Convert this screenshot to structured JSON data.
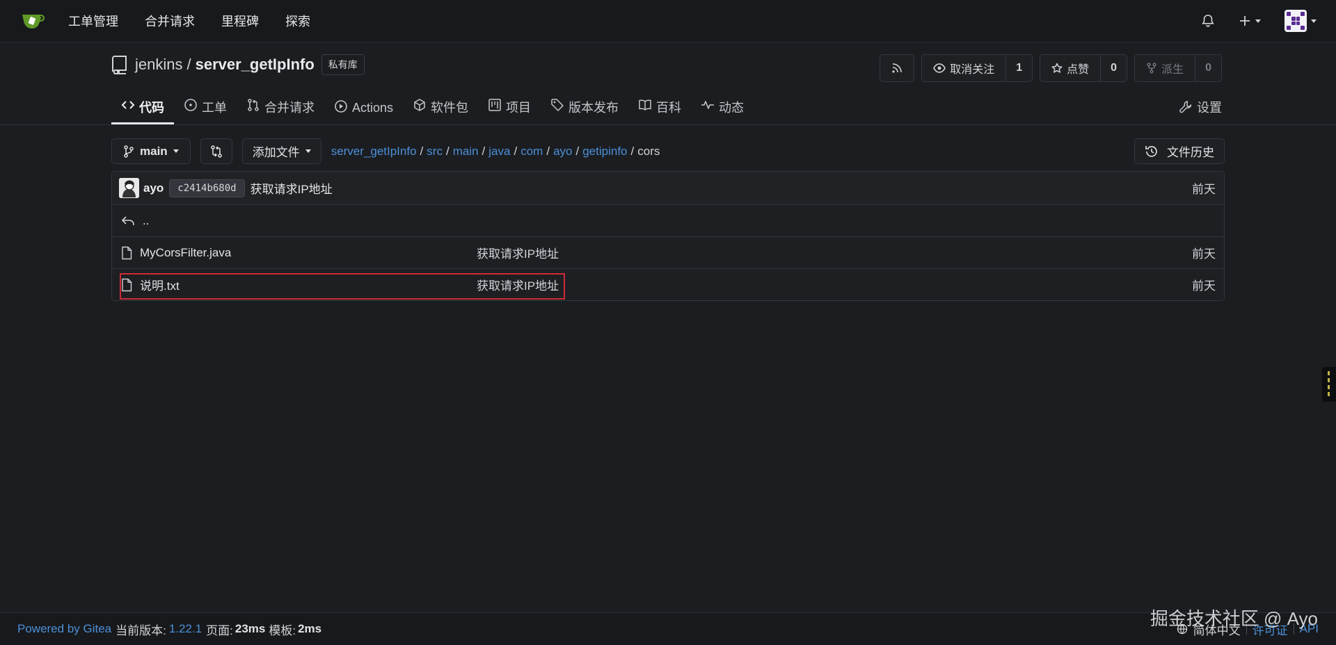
{
  "topnav": {
    "links": [
      "工单管理",
      "合并请求",
      "里程碑",
      "探索"
    ]
  },
  "repo": {
    "owner": "jenkins",
    "separator": "/",
    "name": "server_getIpInfo",
    "private_badge": "私有库",
    "unwatch_label": "取消关注",
    "watch_count": "1",
    "star_label": "点赞",
    "star_count": "0",
    "fork_label": "派生",
    "fork_count": "0"
  },
  "tabs": {
    "code": "代码",
    "issues": "工单",
    "pulls": "合并请求",
    "actions": "Actions",
    "packages": "软件包",
    "projects": "项目",
    "releases": "版本发布",
    "wiki": "百科",
    "activity": "动态",
    "settings": "设置"
  },
  "toolbar": {
    "branch": "main",
    "add_file": "添加文件",
    "history": "文件历史",
    "breadcrumb_links": [
      "server_getIpInfo",
      "src",
      "main",
      "java",
      "com",
      "ayo",
      "getipinfo"
    ],
    "breadcrumb_separator": "/",
    "breadcrumb_current": "cors"
  },
  "commit": {
    "user": "ayo",
    "sha": "c2414b680d",
    "message": "获取请求IP地址",
    "time": "前天"
  },
  "files": {
    "parent": "..",
    "rows": [
      {
        "name": "MyCorsFilter.java",
        "message": "获取请求IP地址",
        "time": "前天"
      },
      {
        "name": "说明.txt",
        "message": "获取请求IP地址",
        "time": "前天"
      }
    ]
  },
  "footer": {
    "powered": "Powered by Gitea",
    "version_label": "当前版本:",
    "version": "1.22.1",
    "page_label": "页面:",
    "page_time": "23ms",
    "template_label": "模板:",
    "template_time": "2ms",
    "language": "简体中文",
    "license": "许可证",
    "api": "API"
  },
  "watermark": "掘金技术社区 @ Ayo",
  "colors": {
    "background": "#1b1d21",
    "link": "#4d8fd6",
    "highlight": "#cf2b35",
    "logo": "#609926"
  }
}
